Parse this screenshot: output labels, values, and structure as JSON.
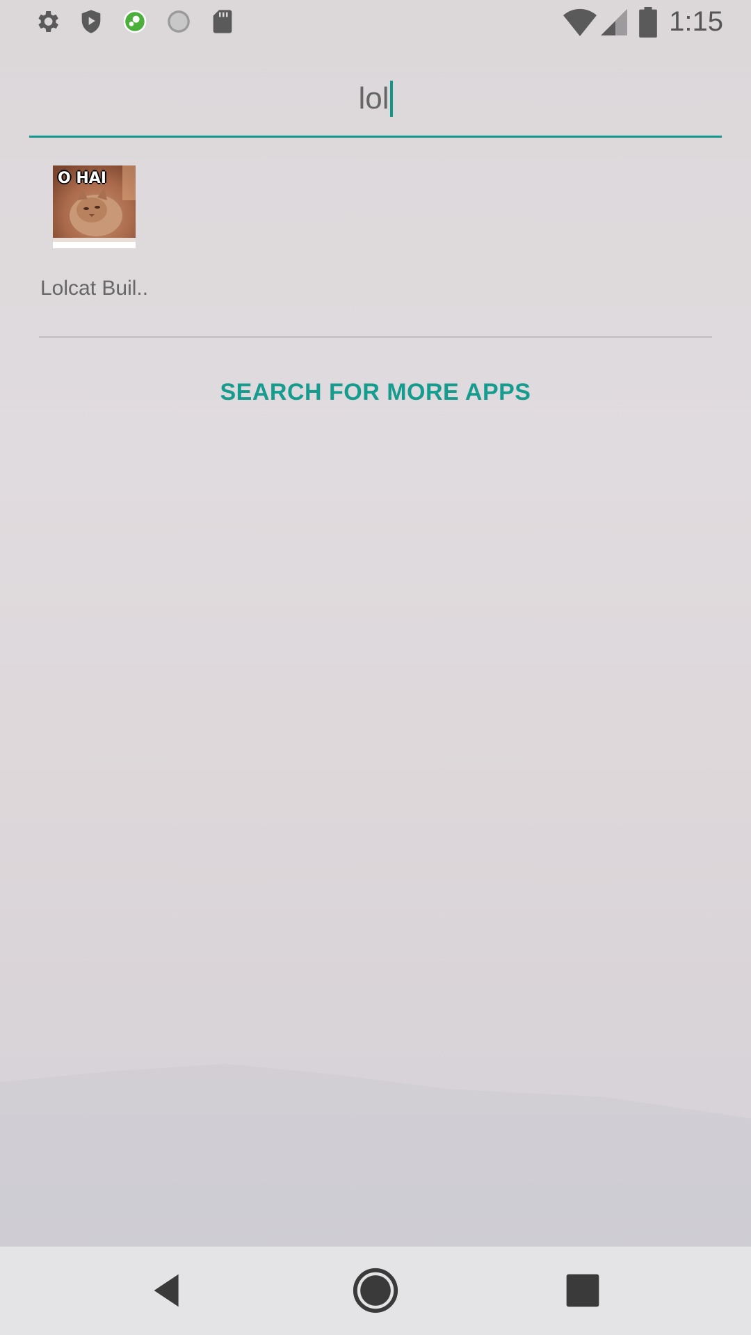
{
  "status_bar": {
    "time": "1:15",
    "left_icons": [
      "settings-icon",
      "shield-icon",
      "green-app-icon",
      "sync-circle-icon",
      "sd-card-icon"
    ],
    "right_icons": [
      "wifi-icon",
      "signal-icon",
      "battery-icon"
    ]
  },
  "search": {
    "value": "lol",
    "accent_color": "#11968b"
  },
  "results": [
    {
      "icon_caption": "O HAI",
      "label": "Lolcat Buil.."
    }
  ],
  "more_apps": {
    "label": "SEARCH FOR MORE APPS",
    "color": "#169c8e"
  },
  "nav_bar": {
    "buttons": [
      "back-icon",
      "home-icon",
      "recents-icon"
    ]
  }
}
